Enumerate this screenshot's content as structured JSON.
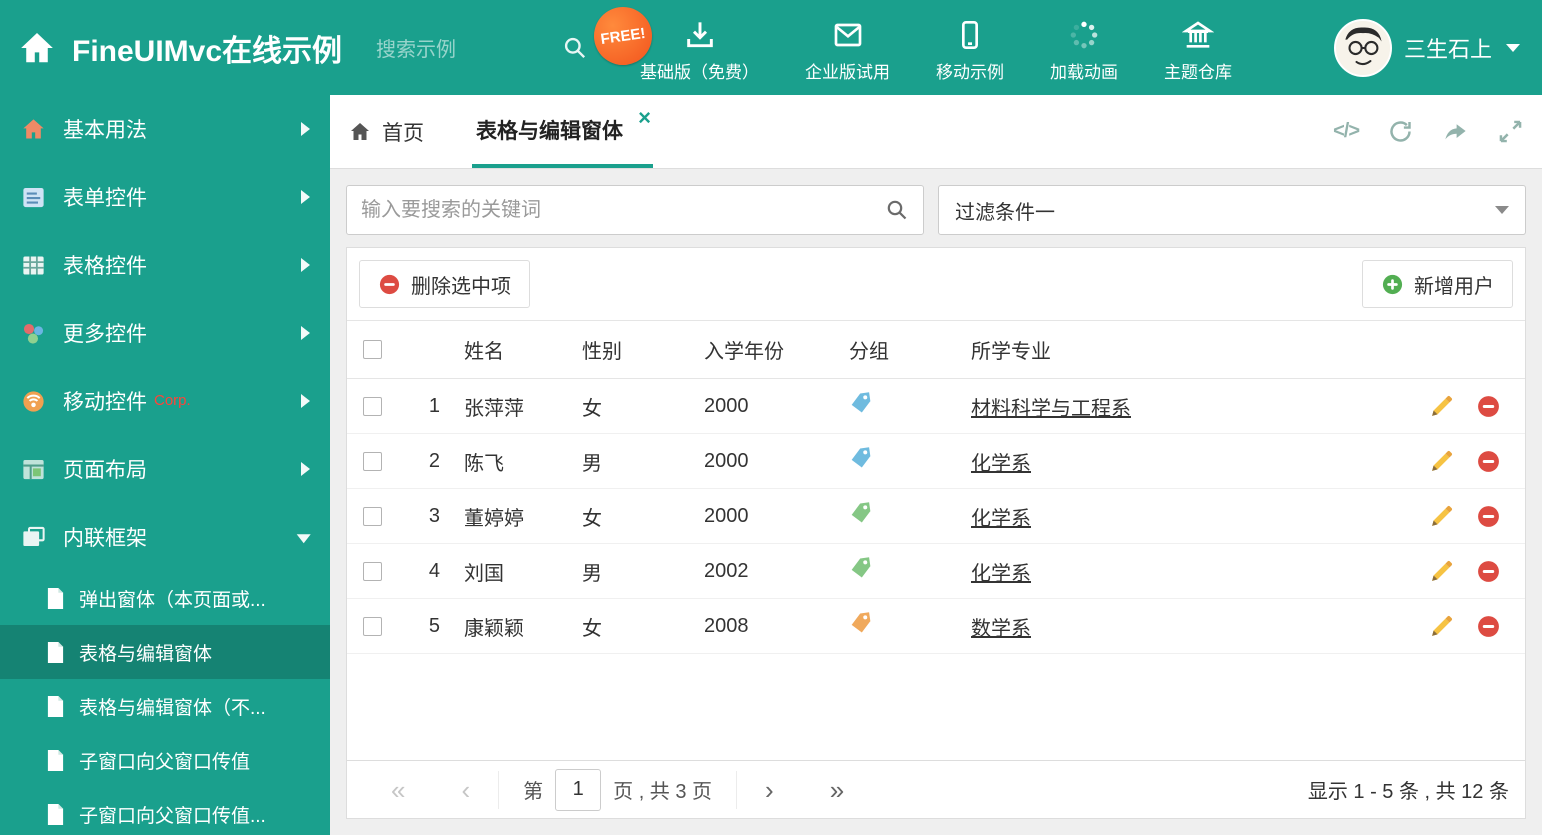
{
  "header": {
    "title": "FineUIMvc在线示例",
    "search_placeholder": "搜索示例",
    "free_badge": "FREE!",
    "nav": [
      {
        "label": "基础版（免费）"
      },
      {
        "label": "企业版试用"
      },
      {
        "label": "移动示例"
      },
      {
        "label": "加载动画"
      },
      {
        "label": "主题仓库"
      }
    ],
    "user_name": "三生石上"
  },
  "sidebar": {
    "items": [
      {
        "label": "基本用法"
      },
      {
        "label": "表单控件"
      },
      {
        "label": "表格控件"
      },
      {
        "label": "更多控件"
      },
      {
        "label": "移动控件",
        "badge": "Corp."
      },
      {
        "label": "页面布局"
      },
      {
        "label": "内联框架",
        "expanded": true
      }
    ],
    "subitems": [
      {
        "label": "弹出窗体（本页面或..."
      },
      {
        "label": "表格与编辑窗体",
        "active": true
      },
      {
        "label": "表格与编辑窗体（不..."
      },
      {
        "label": "子窗口向父窗口传值"
      },
      {
        "label": "子窗口向父窗口传值..."
      }
    ]
  },
  "tabs": {
    "home": "首页",
    "active": "表格与编辑窗体",
    "close_glyph": "×",
    "code_glyph": "</>"
  },
  "filters": {
    "search_placeholder": "输入要搜索的关键词",
    "dropdown_value": "过滤条件一"
  },
  "grid": {
    "delete_button": "删除选中项",
    "add_button": "新增用户",
    "columns": {
      "name": "姓名",
      "gender": "性别",
      "year": "入学年份",
      "group": "分组",
      "major": "所学专业"
    },
    "rows": [
      {
        "num": "1",
        "name": "张萍萍",
        "gender": "女",
        "year": "2000",
        "tag_color": "#6fbbdf",
        "major": "材料科学与工程系"
      },
      {
        "num": "2",
        "name": "陈飞",
        "gender": "男",
        "year": "2000",
        "tag_color": "#6fbbdf",
        "major": "化学系"
      },
      {
        "num": "3",
        "name": "董婷婷",
        "gender": "女",
        "year": "2000",
        "tag_color": "#85c785",
        "major": "化学系"
      },
      {
        "num": "4",
        "name": "刘国",
        "gender": "男",
        "year": "2002",
        "tag_color": "#85c785",
        "major": "化学系"
      },
      {
        "num": "5",
        "name": "康颖颖",
        "gender": "女",
        "year": "2008",
        "tag_color": "#f0a95c",
        "major": "数学系"
      }
    ]
  },
  "pagination": {
    "first": "«",
    "prev": "‹",
    "next": "›",
    "last": "»",
    "page_prefix": "第",
    "page_value": "1",
    "page_suffix": "页 , 共 3 页",
    "summary": "显示 1 - 5 条 , 共 12 条"
  },
  "colors": {
    "accent": "#1aa08d",
    "danger": "#dd4b42",
    "success": "#52ae52",
    "warning": "#f6c343"
  }
}
